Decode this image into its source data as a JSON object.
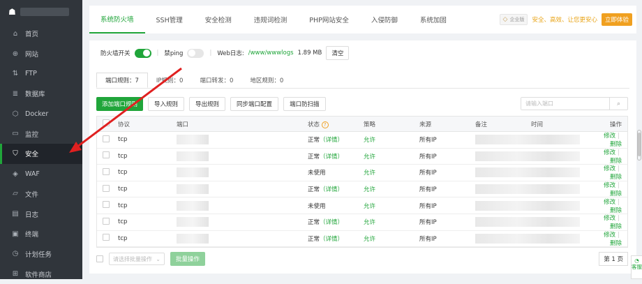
{
  "sidebar": {
    "items": [
      {
        "label": "首页",
        "icon": "home-icon",
        "glyph": "⌂"
      },
      {
        "label": "网站",
        "icon": "globe-icon",
        "glyph": "⊕"
      },
      {
        "label": "FTP",
        "icon": "ftp-icon",
        "glyph": "⇅"
      },
      {
        "label": "数据库",
        "icon": "database-icon",
        "glyph": "≣"
      },
      {
        "label": "Docker",
        "icon": "docker-icon",
        "glyph": "⬡"
      },
      {
        "label": "监控",
        "icon": "monitor-icon",
        "glyph": "▭"
      },
      {
        "label": "安全",
        "icon": "shield-icon",
        "glyph": "⛉"
      },
      {
        "label": "WAF",
        "icon": "waf-icon",
        "glyph": "◈"
      },
      {
        "label": "文件",
        "icon": "folder-icon",
        "glyph": "▱"
      },
      {
        "label": "日志",
        "icon": "log-icon",
        "glyph": "▤"
      },
      {
        "label": "终端",
        "icon": "terminal-icon",
        "glyph": "▣"
      },
      {
        "label": "计划任务",
        "icon": "clock-icon",
        "glyph": "◷"
      },
      {
        "label": "软件商店",
        "icon": "store-icon",
        "glyph": "⊞"
      }
    ],
    "active_index": 6
  },
  "tabs": [
    "系统防火墙",
    "SSH管理",
    "安全检测",
    "违规词检测",
    "PHP网站安全",
    "入侵防御",
    "系统加固"
  ],
  "promo": {
    "badge": "企业版",
    "text": "安全、高效、让您更安心",
    "button": "立即体验"
  },
  "controls": {
    "firewall_label": "防火墙开关",
    "ping_label": "禁ping",
    "weblog_label": "Web日志:",
    "weblog_path": "/www/wwwlogs",
    "weblog_size": "1.89 MB",
    "clear_button": "清空"
  },
  "subtabs": [
    {
      "label": "端口规则：7"
    },
    {
      "label": "IP规则：0"
    },
    {
      "label": "端口转发：0"
    },
    {
      "label": "地区规则：0"
    }
  ],
  "actions": {
    "add": "添加端口规则",
    "import": "导入规则",
    "export": "导出规则",
    "sync": "同步端口配置",
    "scan": "端口防扫描"
  },
  "search": {
    "placeholder": "请输入端口"
  },
  "table": {
    "headers": {
      "protocol": "协议",
      "port": "端口",
      "status": "状态",
      "policy": "策略",
      "source": "来源",
      "remark": "备注",
      "time": "时间",
      "ops": "操作"
    },
    "rows": [
      {
        "protocol": "tcp",
        "status": "正常",
        "detail": "（详情）",
        "policy": "允许",
        "source": "所有IP"
      },
      {
        "protocol": "tcp",
        "status": "正常",
        "detail": "（详情）",
        "policy": "允许",
        "source": "所有IP"
      },
      {
        "protocol": "tcp",
        "status": "未使用",
        "detail": "",
        "policy": "允许",
        "source": "所有IP"
      },
      {
        "protocol": "tcp",
        "status": "正常",
        "detail": "（详情）",
        "policy": "允许",
        "source": "所有IP"
      },
      {
        "protocol": "tcp",
        "status": "未使用",
        "detail": "",
        "policy": "允许",
        "source": "所有IP"
      },
      {
        "protocol": "tcp",
        "status": "正常",
        "detail": "（详情）",
        "policy": "允许",
        "source": "所有IP"
      },
      {
        "protocol": "tcp",
        "status": "正常",
        "detail": "（详情）",
        "policy": "允许",
        "source": "所有IP"
      }
    ],
    "edit_label": "修改",
    "delete_label": "删除"
  },
  "footer": {
    "batch_placeholder": "请选择批量操作",
    "batch_button": "批量操作",
    "page": "第 1 页"
  },
  "service_label": "客服",
  "colors": {
    "accent": "#20a53a",
    "promo": "#f0a020",
    "arrow": "#e02020"
  }
}
